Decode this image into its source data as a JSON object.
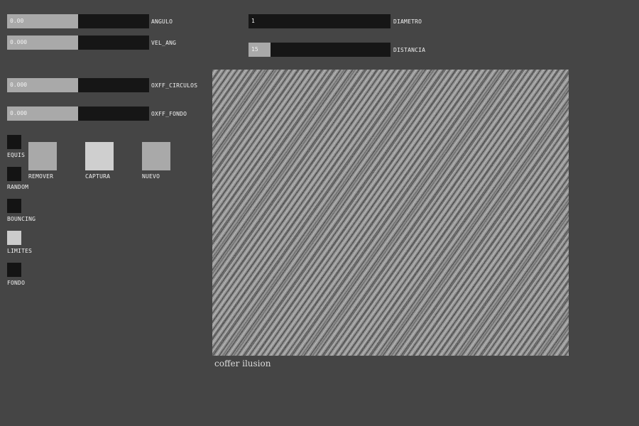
{
  "sliders": {
    "angulo": {
      "label": "ANGULO",
      "value": "0.00",
      "fill_fraction": 0.5
    },
    "vel_ang": {
      "label": "VEL_ANG",
      "value": "0.000",
      "fill_fraction": 0.5
    },
    "oxff_circulos": {
      "label": "OXFF_CIRCULOS",
      "value": "0.000",
      "fill_fraction": 0.5
    },
    "oxff_fondo": {
      "label": "OXFF_FONDO",
      "value": "0.000",
      "fill_fraction": 0.5
    },
    "diametro": {
      "label": "DIAMETRO",
      "value": "1",
      "fill_fraction": 0.0
    },
    "distancia": {
      "label": "DISTANCIA",
      "value": "15",
      "fill_fraction": 0.155
    }
  },
  "toggles": {
    "equis": {
      "label": "EQUIS",
      "state": false
    },
    "random": {
      "label": "RANDOM",
      "state": false
    },
    "bouncing": {
      "label": "BOUNCING",
      "state": false
    },
    "limites": {
      "label": "LIMITES",
      "state": true
    },
    "fondo": {
      "label": "FONDO",
      "state": false
    }
  },
  "buttons": {
    "remover": {
      "label": "REMOVER"
    },
    "captura": {
      "label": "CAPTURA"
    },
    "nuevo": {
      "label": "NUEVO"
    }
  },
  "canvas": {
    "caption": "coffer ilusion",
    "pattern": "diagonal grayscale noise stripes"
  },
  "colors": {
    "background": "#454545",
    "slider_track": "#161616",
    "slider_fill": "#a9a9a9",
    "toggle_off": "#141414",
    "toggle_on": "#cccccc",
    "button": "#a9a9a9",
    "button_highlight": "#cfcfcf"
  }
}
